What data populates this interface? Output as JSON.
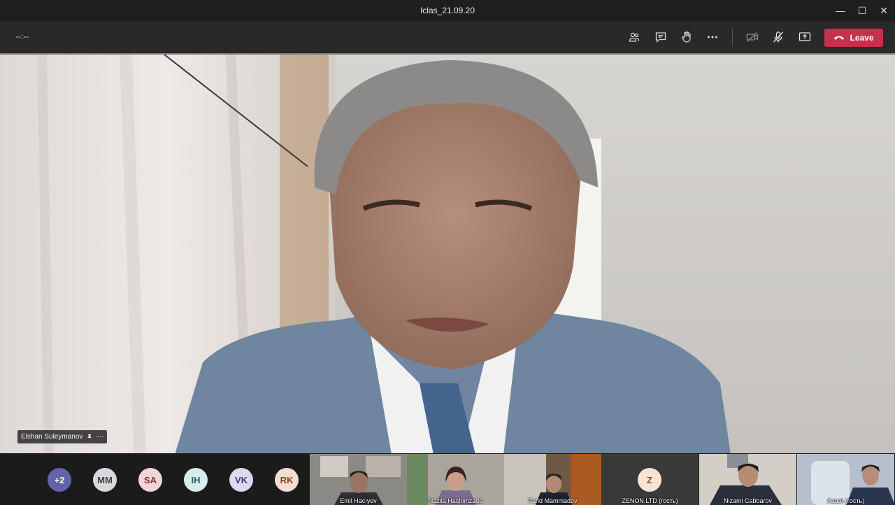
{
  "window": {
    "title": "Iclas_21.09.20",
    "minimize": "—",
    "maximize": "☐",
    "close": "✕"
  },
  "toolbar": {
    "timer": "--:--",
    "leave_label": "Leave"
  },
  "main_speaker": {
    "name": "Elshan Suleymanov",
    "more": "···"
  },
  "overflow": {
    "label": "+2"
  },
  "avatars": [
    {
      "initials": "MM",
      "bg": "#d8d8dc",
      "fg": "#3f3f46"
    },
    {
      "initials": "SA",
      "bg": "#f0d7d7",
      "fg": "#8a2f2f"
    },
    {
      "initials": "IH",
      "bg": "#d7ecec",
      "fg": "#2f6262"
    },
    {
      "initials": "VK",
      "bg": "#dcdaf2",
      "fg": "#3f3a7a"
    },
    {
      "initials": "RK",
      "bg": "#f5ddd1",
      "fg": "#8a3f2a"
    }
  ],
  "participants": [
    {
      "name": "Emil Hacıyev"
    },
    {
      "name": "Nazila Hashimzade"
    },
    {
      "name": "Farid Mammadov"
    },
    {
      "name": "ZENON.LTD (гость)",
      "initial": "Z"
    },
    {
      "name": "Nizami Cabbarov"
    },
    {
      "name": "Aaaa\\ (гость)"
    }
  ],
  "colors": {
    "leave": "#c4314b",
    "overflow_bg": "#6264a7"
  }
}
